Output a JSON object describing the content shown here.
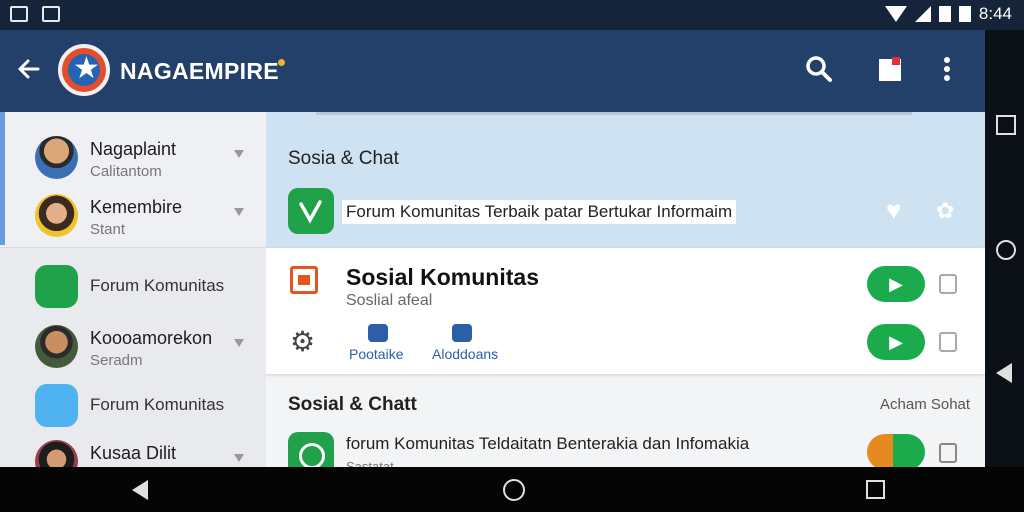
{
  "status_bar": {
    "time": "8:44"
  },
  "app_bar": {
    "brand": "NAGAEMPIRE"
  },
  "drawer": {
    "items": [
      {
        "title": "Nagaplaint",
        "subtitle": "Calitantom"
      },
      {
        "title": "Kemembire",
        "subtitle": "Stant"
      },
      {
        "title": "Forum Komunitas",
        "subtitle": ""
      },
      {
        "title": "Koooamorekon",
        "subtitle": "Seradm"
      },
      {
        "title": "Forum Komunitas",
        "subtitle": ""
      },
      {
        "title": "Kusaa Dilit",
        "subtitle": ""
      }
    ]
  },
  "main": {
    "section_a": {
      "title": "Sosia & Chat",
      "row_text": "Forum Komunitas Terbaik patar Bertukar Informaim"
    },
    "card": {
      "title": "Sosial Komunitas",
      "subtitle": "Soslial afeal",
      "links": [
        "Pootaike",
        "Aloddoans"
      ]
    },
    "section_c": {
      "title": "Sosial & Chatt",
      "right_label": "Acham Sohat",
      "row_text": "forum Komunitas Teldaitatn Benterakia dan Infomakia",
      "row_sub": "Sastatat"
    }
  },
  "colors": {
    "appbar": "#22406a",
    "accent_green": "#1bab4d",
    "section_highlight": "#cfe2f1"
  }
}
